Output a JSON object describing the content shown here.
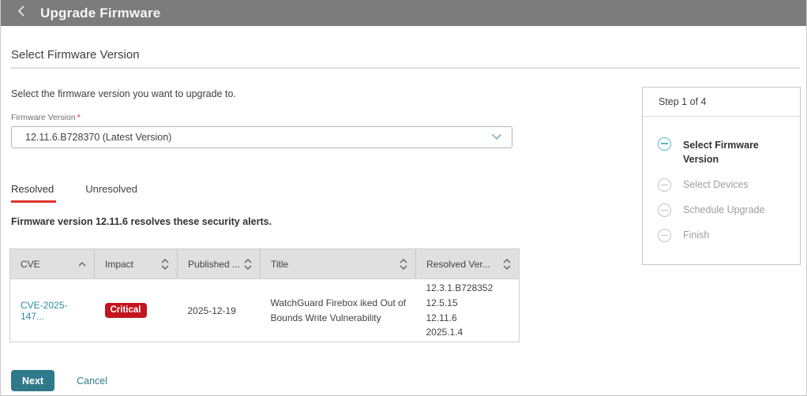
{
  "header": {
    "title": "Upgrade Firmware"
  },
  "section": {
    "title": "Select Firmware Version"
  },
  "intro": "Select the firmware version you want to upgrade to.",
  "firmware_select": {
    "label": "Firmware Version",
    "required_marker": "*",
    "value": "12.11.6.B728370 (Latest Version)"
  },
  "tabs": [
    {
      "label": "Resolved",
      "active": true
    },
    {
      "label": "Unresolved",
      "active": false
    }
  ],
  "alert_summary": "Firmware version 12.11.6 resolves these security alerts.",
  "table": {
    "columns": [
      {
        "label": "CVE",
        "sort": "ascending"
      },
      {
        "label": "Impact",
        "sort": "none"
      },
      {
        "label": "Published ...",
        "sort": "none"
      },
      {
        "label": "Title",
        "sort": "none"
      },
      {
        "label": "Resolved Ver...",
        "sort": "none"
      }
    ],
    "rows": [
      {
        "cve": "CVE-2025-147...",
        "impact": "Critical",
        "published": "2025-12-19",
        "title": "WatchGuard Firebox iked Out of Bounds Write Vulnerability",
        "resolved_versions": [
          "12.3.1.B728352",
          "12.5.15",
          "12.11.6",
          "2025.1.4"
        ]
      }
    ]
  },
  "wizard": {
    "header": "Step 1 of 4",
    "steps": [
      {
        "label": "Select Firmware Version",
        "state": "current"
      },
      {
        "label": "Select Devices",
        "state": "upcoming"
      },
      {
        "label": "Schedule Upgrade",
        "state": "upcoming"
      },
      {
        "label": "Finish",
        "state": "upcoming"
      }
    ]
  },
  "footer": {
    "next": "Next",
    "cancel": "Cancel"
  },
  "colors": {
    "header_bg": "#7c7c7c",
    "accent_teal": "#30798a",
    "link_teal": "#2d8ba1",
    "critical_red": "#c3141e",
    "tab_underline_red": "#e0332c",
    "step_current": "#58b5cb",
    "table_header_bg": "#e0e0e0"
  }
}
